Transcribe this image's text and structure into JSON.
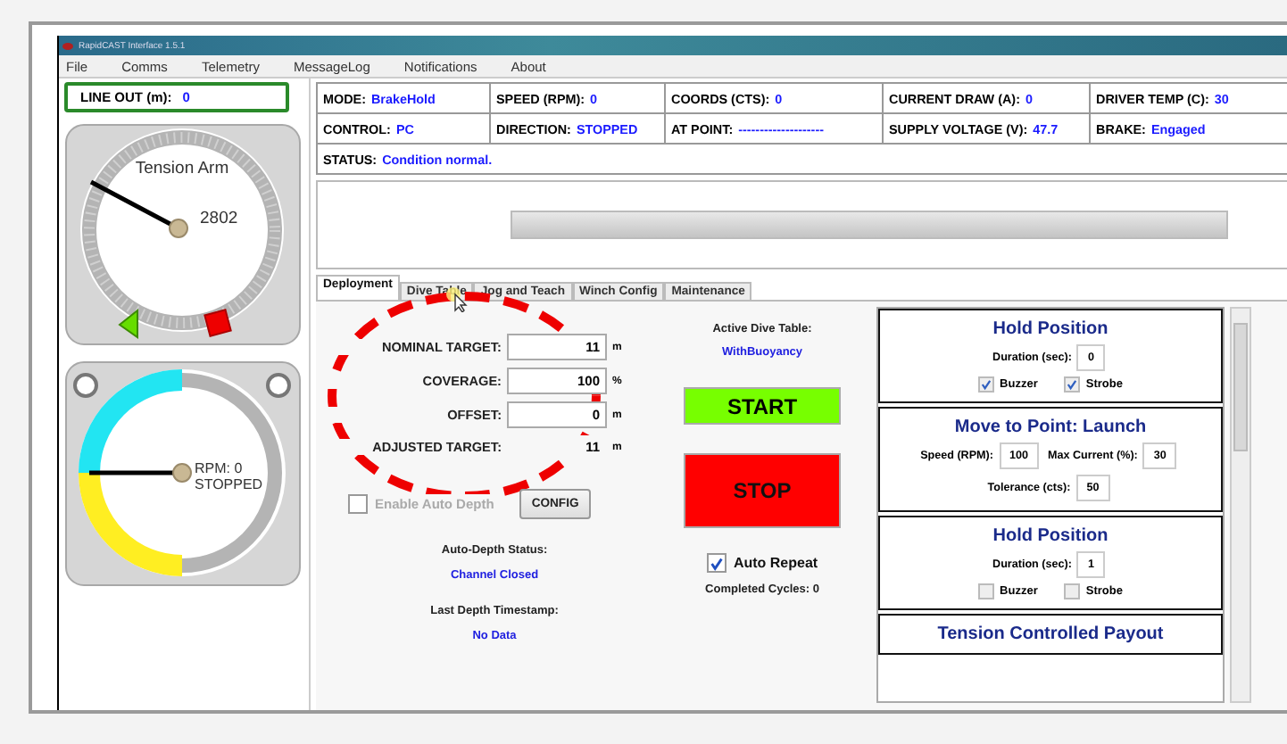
{
  "window": {
    "title": "RapidCAST Interface 1.5.1"
  },
  "menu": [
    "File",
    "Comms",
    "Telemetry",
    "MessageLog",
    "Notifications",
    "About"
  ],
  "line_out": {
    "label": "LINE OUT (m):",
    "value": "0"
  },
  "tension_gauge": {
    "title": "Tension Arm",
    "reading": "2802"
  },
  "rpm_gauge": {
    "reading": "RPM: 0",
    "state": "STOPPED"
  },
  "status_rows": [
    [
      {
        "label": "MODE:",
        "value": "BrakeHold"
      },
      {
        "label": "SPEED (RPM):",
        "value": "0"
      },
      {
        "label": "COORDS (CTS):",
        "value": "0"
      },
      {
        "label": "CURRENT DRAW (A):",
        "value": "0"
      },
      {
        "label": "DRIVER TEMP (C):",
        "value": "30"
      }
    ],
    [
      {
        "label": "CONTROL:",
        "value": "PC"
      },
      {
        "label": "DIRECTION:",
        "value": "STOPPED"
      },
      {
        "label": "AT POINT:",
        "value": "--------------------"
      },
      {
        "label": "SUPPLY VOLTAGE (V):",
        "value": "47.7"
      },
      {
        "label": "BRAKE:",
        "value": "Engaged"
      }
    ],
    [
      {
        "label": "STATUS:",
        "value": "Condition normal."
      }
    ]
  ],
  "progress": {
    "level": 0
  },
  "tabs": [
    {
      "label": "Deployment",
      "selected": true
    },
    {
      "label": "Dive Table",
      "selected": false
    },
    {
      "label": "Jog and Teach",
      "selected": false
    },
    {
      "label": "Winch Config",
      "selected": false
    },
    {
      "label": "Maintenance",
      "selected": false
    }
  ],
  "form": [
    {
      "label": "NOMINAL TARGET:",
      "value": "11",
      "unit": "m",
      "kind": "input"
    },
    {
      "label": "COVERAGE:",
      "value": "100",
      "unit": "%",
      "kind": "input"
    },
    {
      "label": "OFFSET:",
      "value": "0",
      "unit": "m",
      "kind": "input"
    },
    {
      "label": "ADJUSTED TARGET:",
      "value": "11",
      "unit": "m",
      "kind": "readout"
    }
  ],
  "auto_depth": {
    "label": "Enable Auto Depth",
    "checked": false,
    "disabled": true
  },
  "config_button": "CONFIG",
  "auto_depth_status": {
    "label": "Auto-Depth Status:",
    "value": "Channel Closed"
  },
  "last_depth": {
    "label": "Last Depth Timestamp:",
    "value": "No Data"
  },
  "dive_table": {
    "label": "Active Dive Table:",
    "value": "WithBuoyancy"
  },
  "start_button": "START",
  "stop_button": "STOP",
  "auto_repeat": {
    "label": "Auto Repeat",
    "checked": true
  },
  "cycles": {
    "label": "Completed Cycles:",
    "value": "0"
  },
  "steps": [
    {
      "title": "Hold Position",
      "rows": [
        [
          {
            "label": "Duration (sec):",
            "value": "0"
          }
        ]
      ],
      "options": [
        {
          "label": "Buzzer",
          "checked": true
        },
        {
          "label": "Strobe",
          "checked": true
        }
      ]
    },
    {
      "title": "Move to Point: Launch",
      "rows": [
        [
          {
            "label": "Speed (RPM):",
            "value": "100"
          },
          {
            "label": "Max Current (%):",
            "value": "30"
          }
        ],
        [
          {
            "label": "Tolerance (cts):",
            "value": "50"
          }
        ]
      ]
    },
    {
      "title": "Hold Position",
      "rows": [
        [
          {
            "label": "Duration (sec):",
            "value": "1"
          }
        ]
      ],
      "options": [
        {
          "label": "Buzzer",
          "checked": false
        },
        {
          "label": "Strobe",
          "checked": false
        }
      ]
    },
    {
      "title": "Tension Controlled Payout"
    }
  ]
}
